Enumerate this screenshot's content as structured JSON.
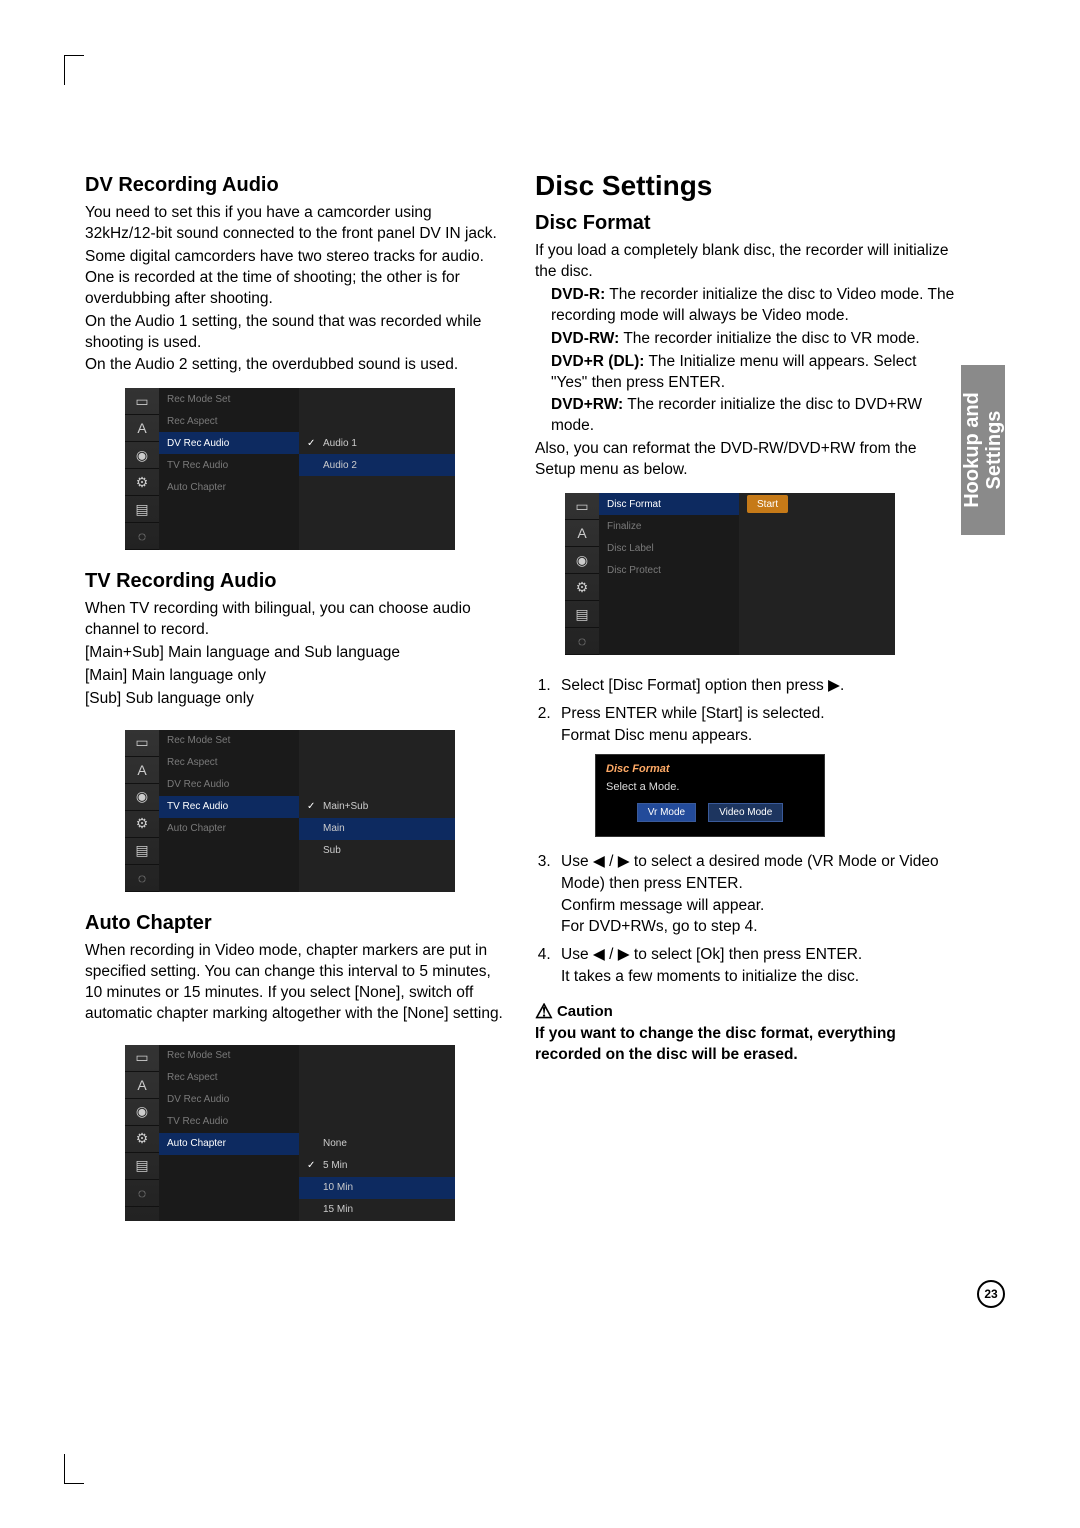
{
  "sidetab": {
    "line1": "Hookup and",
    "line2": "Settings"
  },
  "page_number": "23",
  "left": {
    "dv_audio": {
      "heading": "DV Recording Audio",
      "p1": "You need to set this if you have a camcorder using 32kHz/12-bit sound connected to the front panel DV IN jack.",
      "p2": "Some digital camcorders have two stereo tracks for audio. One is recorded at the time of shooting; the other is for overdubbing after shooting.",
      "p3": "On the Audio 1 setting, the sound that was recorded while shooting is used.",
      "p4": "On the Audio 2 setting, the overdubbed sound is used.",
      "menu": {
        "items": [
          "Rec Mode Set",
          "Rec Aspect",
          "DV Rec Audio",
          "TV Rec Audio",
          "Auto Chapter"
        ],
        "sel_index": 2,
        "options": [
          "Audio 1",
          "Audio 2"
        ],
        "opt_sel_index": 0
      }
    },
    "tv_audio": {
      "heading": "TV Recording Audio",
      "p1": "When TV recording with bilingual, you can choose audio channel to record.",
      "l1": "[Main+Sub] Main language and Sub language",
      "l2": "[Main] Main language only",
      "l3": "[Sub] Sub language only",
      "menu": {
        "items": [
          "Rec Mode Set",
          "Rec Aspect",
          "DV Rec Audio",
          "TV Rec Audio",
          "Auto Chapter"
        ],
        "sel_index": 3,
        "options": [
          "Main+Sub",
          "Main",
          "Sub"
        ],
        "opt_sel_index": 0
      }
    },
    "auto_chapter": {
      "heading": "Auto Chapter",
      "p1": "When recording in Video mode, chapter markers are put in specified setting. You can change this interval to 5 minutes, 10 minutes or 15 minutes. If you select [None], switch off automatic chapter marking altogether with the [None] setting.",
      "menu": {
        "items": [
          "Rec Mode Set",
          "Rec Aspect",
          "DV Rec Audio",
          "TV Rec Audio",
          "Auto Chapter"
        ],
        "sel_index": 4,
        "options": [
          "None",
          "5 Min",
          "10 Min",
          "15 Min"
        ],
        "opt_sel_index": 1
      }
    }
  },
  "right": {
    "title": "Disc Settings",
    "disc_format": {
      "heading": "Disc Format",
      "intro": "If you load a completely blank disc, the recorder will initialize the disc.",
      "dvd_r_label": "DVD-R:",
      "dvd_r_text": " The recorder initialize the disc to Video mode. The recording mode will always be Video mode.",
      "dvd_rw_label": "DVD-RW:",
      "dvd_rw_text": " The recorder initialize the disc to VR mode.",
      "dvd_r_dl_label": "DVD+R (DL):",
      "dvd_r_dl_text": " The Initialize menu will appears. Select \"Yes\" then press ENTER.",
      "dvd_plus_rw_label": "DVD+RW:",
      "dvd_plus_rw_text": " The recorder initialize the disc to DVD+RW mode.",
      "also": "Also, you can reformat the DVD-RW/DVD+RW from the Setup menu as below.",
      "menu": {
        "items": [
          "Disc Format",
          "Finalize",
          "Disc Label",
          "Disc Protect"
        ],
        "sel_index": 0,
        "button": "Start"
      },
      "steps": {
        "s1": "Select [Disc Format] option then press ▶.",
        "s2a": "Press ENTER while [Start] is selected.",
        "s2b": "Format Disc menu appears.",
        "s3a": "Use ◀ / ▶ to select a desired mode (VR Mode or Video Mode) then press ENTER.",
        "s3b": "Confirm message will appear.",
        "s3c": "For DVD+RWs, go to step 4.",
        "s4a": "Use ◀ / ▶ to select [Ok] then press ENTER.",
        "s4b": "It takes a few moments to initialize the disc."
      },
      "dialog": {
        "title": "Disc Format",
        "sub": "Select a Mode.",
        "btn1": "Vr Mode",
        "btn2": "Video Mode"
      },
      "caution_label": "Caution",
      "caution_text": "If you want to change the disc format, everything recorded on the disc will be erased."
    }
  },
  "panel_icons": [
    "▭",
    "A",
    "◉",
    "⚙",
    "▤",
    "◌"
  ]
}
